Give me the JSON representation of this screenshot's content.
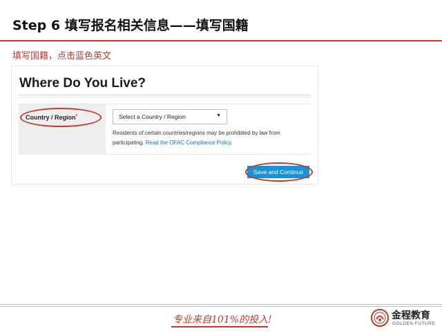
{
  "slide": {
    "title": "Step 6 填写报名相关信息——填写国籍",
    "instruction": "填写国籍，点击蓝色英文"
  },
  "form": {
    "heading": "Where Do You Live?",
    "country_label": "Country / Region",
    "required_mark": "*",
    "select_value": "Select a Country / Region",
    "help_text": "Residents of certain countries/regions may be prohibited by law from participating.",
    "help_link": "Read the OFAC Compliance Policy.",
    "submit_label": "Save and Continue"
  },
  "footer": {
    "slogan": "专业来自101%的投入!",
    "logo_cn": "金程教育",
    "logo_en": "GOLDEN FUTURE"
  },
  "colors": {
    "accent_red": "#c0392b",
    "button_blue": "#1b93d2",
    "link_blue": "#1a6fc4"
  }
}
